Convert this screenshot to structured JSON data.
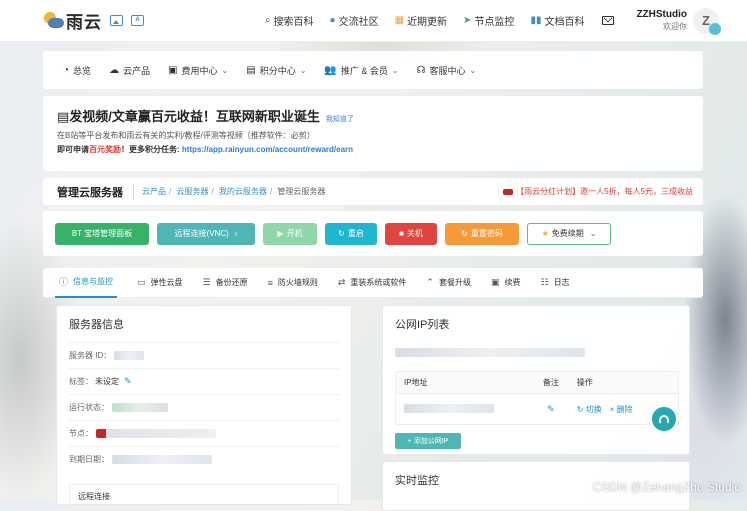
{
  "brand": {
    "name": "雨云"
  },
  "topnav": [
    {
      "label": "搜索百科",
      "icon": "search-icon"
    },
    {
      "label": "交流社区",
      "icon": "community-icon"
    },
    {
      "label": "近期更新",
      "icon": "calendar-icon"
    },
    {
      "label": "节点监控",
      "icon": "location-icon"
    },
    {
      "label": "文档百科",
      "icon": "book-icon"
    }
  ],
  "user": {
    "name": "ZZHStudio",
    "subtitle": "欢迎你",
    "avatar_letter": "Z"
  },
  "mainnav": [
    {
      "label": "总览",
      "icon": "dashboard-icon",
      "dropdown": false
    },
    {
      "label": "云产品",
      "icon": "cloud-icon",
      "dropdown": false
    },
    {
      "label": "费用中心",
      "icon": "wallet-icon",
      "dropdown": true
    },
    {
      "label": "积分中心",
      "icon": "points-icon",
      "dropdown": true
    },
    {
      "label": "推广 & 会员",
      "icon": "users-icon",
      "dropdown": true
    },
    {
      "label": "客服中心",
      "icon": "headset-icon",
      "dropdown": true
    }
  ],
  "announcement": {
    "title": "发视频/文章赢百元收益！互联网新职业诞生",
    "know_link": "我知道了",
    "line1": "在B站等平台发布和雨云有关的实利/教程/评测等视频（推荐软件：必剪）",
    "line2_prefix": "即可申请",
    "line2_reward": "百元奖励",
    "line2_mid": "！更多积分任务: ",
    "line2_url": "https://app.rainyun.com/account/reward/earn"
  },
  "page": {
    "title": "管理云服务器",
    "breadcrumbs": [
      "云产品",
      "云服务器",
      "我的云服务器",
      "管理云服务器"
    ],
    "promo": "【雨云分红计划】邀一人5折，每人5元，三成收益"
  },
  "actions": {
    "bt_panel": "BT 宝塔管理面板",
    "vnc": "远程连接(VNC)",
    "power_on": "开机",
    "restart": "重启",
    "power_off": "关机",
    "reset_password": "重置密码",
    "renew": "免费续期"
  },
  "tabs": [
    {
      "label": "信息与监控",
      "active": true,
      "icon": "info-icon"
    },
    {
      "label": "弹性云盘",
      "active": false,
      "icon": "disk-icon"
    },
    {
      "label": "备份还原",
      "active": false,
      "icon": "backup-icon"
    },
    {
      "label": "防火墙规则",
      "active": false,
      "icon": "firewall-icon"
    },
    {
      "label": "重装系统或软件",
      "active": false,
      "icon": "reinstall-icon"
    },
    {
      "label": "套餐升级",
      "active": false,
      "icon": "upgrade-icon"
    },
    {
      "label": "续费",
      "active": false,
      "icon": "renew-icon"
    },
    {
      "label": "日志",
      "active": false,
      "icon": "log-icon"
    }
  ],
  "server_info": {
    "title": "服务器信息",
    "id_label": "服务器 ID：",
    "tag_label": "标签：",
    "tag_value": "未设定",
    "status_label": "运行状态：",
    "node_label": "节点：",
    "expire_label": "到期日期：",
    "remote_label": "远程连接"
  },
  "public_ip": {
    "title": "公网IP列表",
    "columns": [
      "IP地址",
      "备注",
      "操作"
    ],
    "switch_label": "切换",
    "delete_label": "× 删除",
    "add_label": "+ 添加公网IP"
  },
  "monitor": {
    "title": "实时监控"
  },
  "watermark": "CSDN @ZehangZhu Studio",
  "colors": {
    "primary": "#1f8fd0",
    "green": "#35b36b",
    "teal": "#4fb6b7",
    "red": "#e0463f",
    "orange": "#f59a36"
  }
}
